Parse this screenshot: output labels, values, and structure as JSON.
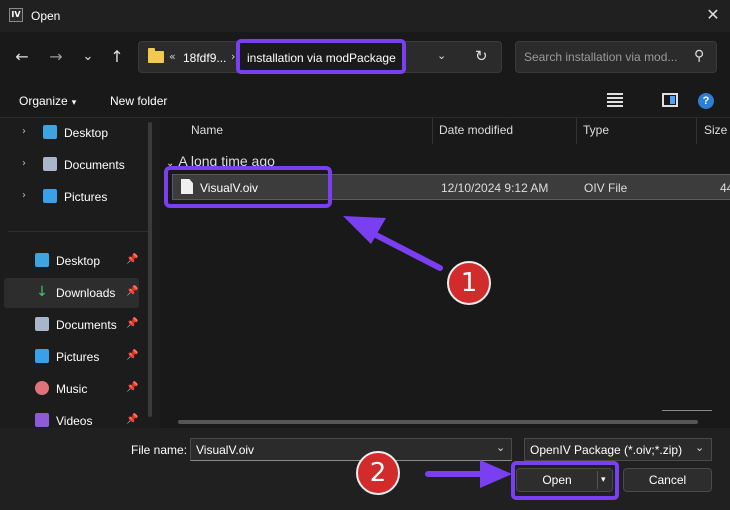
{
  "window": {
    "app_icon_text": "IV",
    "title": "Open",
    "close_glyph": "✕"
  },
  "nav": {
    "back": "←",
    "forward": "→",
    "recent": "⌄",
    "up": "↑"
  },
  "address": {
    "overflow": "«",
    "crumbs": [
      "18fdf9...",
      "installation via modPackage"
    ],
    "separator": "›",
    "dropdown": "⌄",
    "refresh": "↻"
  },
  "search": {
    "placeholder": "Search installation via mod...",
    "icon_glyph": "⚲"
  },
  "commands": {
    "organize": "Organize",
    "organize_dd": "▾",
    "new_folder": "New folder",
    "help": "?"
  },
  "sidebar": {
    "items": [
      {
        "label": "Desktop",
        "icon": "desktop-icon",
        "chevron": "›"
      },
      {
        "label": "Documents",
        "icon": "documents-icon",
        "chevron": "›"
      },
      {
        "label": "Pictures",
        "icon": "pictures-icon",
        "chevron": "›"
      },
      {
        "label": "Desktop",
        "icon": "desktop-icon",
        "pin": "📌"
      },
      {
        "label": "Downloads",
        "icon": "downloads-icon",
        "pin": "📌"
      },
      {
        "label": "Documents",
        "icon": "documents-icon",
        "pin": "📌"
      },
      {
        "label": "Pictures",
        "icon": "pictures-icon",
        "pin": "📌"
      },
      {
        "label": "Music",
        "icon": "music-icon",
        "pin": "📌"
      },
      {
        "label": "Videos",
        "icon": "videos-icon",
        "pin": "📌"
      }
    ]
  },
  "columns": {
    "name": "Name",
    "date": "Date modified",
    "type": "Type",
    "size": "Size",
    "sort_glyph": "⌃"
  },
  "group": {
    "chevron": "⌄",
    "label": "A long time ago"
  },
  "file": {
    "name": "VisualV.oiv",
    "date": "12/10/2024 9:12 AM",
    "type": "OIV File",
    "size": "44"
  },
  "footer": {
    "file_name_label": "File name:",
    "file_name_value": "VisualV.oiv",
    "file_type": "OpenIV Package (*.oiv;*.zip)",
    "dd_glyph": "⌄",
    "open": "Open",
    "open_split_glyph": "▾",
    "cancel": "Cancel"
  },
  "annotations": {
    "step1": "1",
    "step2": "2"
  },
  "colors": {
    "highlight": "#7b3ff2",
    "badge": "#d12b2b",
    "folder": "#f2c94c"
  }
}
